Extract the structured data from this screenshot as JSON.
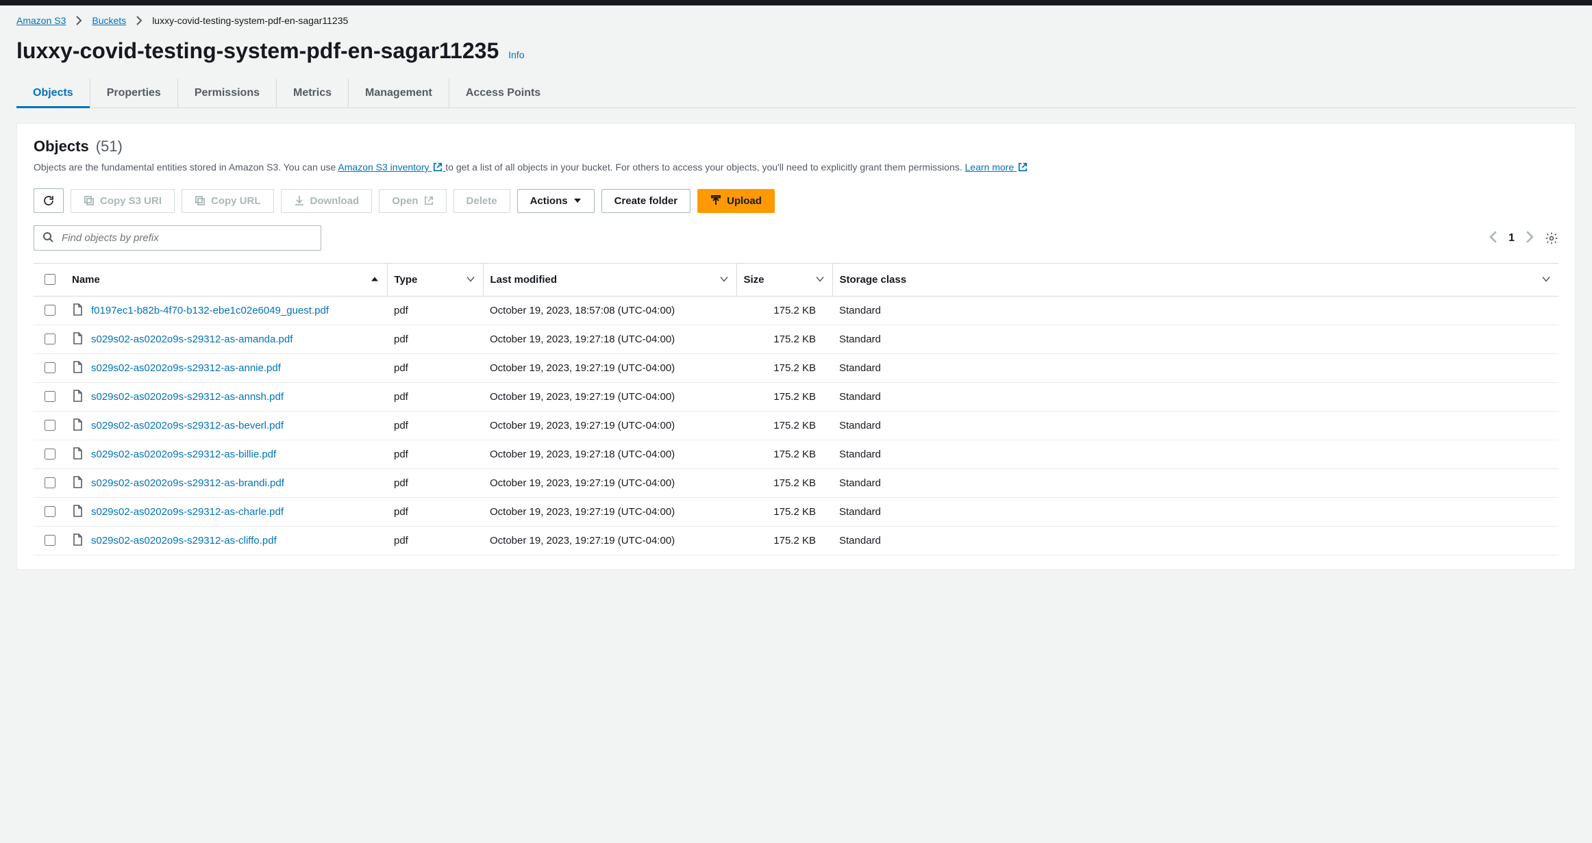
{
  "breadcrumbs": {
    "root": "Amazon S3",
    "buckets": "Buckets",
    "current": "luxxy-covid-testing-system-pdf-en-sagar11235"
  },
  "page_title": "luxxy-covid-testing-system-pdf-en-sagar11235",
  "info_label": "Info",
  "tabs": {
    "objects": "Objects",
    "properties": "Properties",
    "permissions": "Permissions",
    "metrics": "Metrics",
    "management": "Management",
    "access_points": "Access Points"
  },
  "panel": {
    "title": "Objects",
    "count": "(51)",
    "desc_pre": "Objects are the fundamental entities stored in Amazon S3. You can use ",
    "inventory_link": "Amazon S3 inventory ",
    "desc_mid": " to get a list of all objects in your bucket. For others to access your objects, you'll need to explicitly grant them permissions. ",
    "learn_more": "Learn more "
  },
  "toolbar": {
    "copy_s3_uri": "Copy S3 URI",
    "copy_url": "Copy URL",
    "download": "Download",
    "open": "Open",
    "delete": "Delete",
    "actions": "Actions",
    "create_folder": "Create folder",
    "upload": "Upload"
  },
  "search": {
    "placeholder": "Find objects by prefix"
  },
  "pager": {
    "page": "1"
  },
  "columns": {
    "name": "Name",
    "type": "Type",
    "last_modified": "Last modified",
    "size": "Size",
    "storage_class": "Storage class"
  },
  "rows": [
    {
      "name": "f0197ec1-b82b-4f70-b132-ebe1c02e6049_guest.pdf",
      "type": "pdf",
      "last_modified": "October 19, 2023, 18:57:08 (UTC-04:00)",
      "size": "175.2 KB",
      "storage_class": "Standard"
    },
    {
      "name": "s029s02-as0202o9s-s29312-as-amanda.pdf",
      "type": "pdf",
      "last_modified": "October 19, 2023, 19:27:18 (UTC-04:00)",
      "size": "175.2 KB",
      "storage_class": "Standard"
    },
    {
      "name": "s029s02-as0202o9s-s29312-as-annie.pdf",
      "type": "pdf",
      "last_modified": "October 19, 2023, 19:27:19 (UTC-04:00)",
      "size": "175.2 KB",
      "storage_class": "Standard"
    },
    {
      "name": "s029s02-as0202o9s-s29312-as-annsh.pdf",
      "type": "pdf",
      "last_modified": "October 19, 2023, 19:27:19 (UTC-04:00)",
      "size": "175.2 KB",
      "storage_class": "Standard"
    },
    {
      "name": "s029s02-as0202o9s-s29312-as-beverl.pdf",
      "type": "pdf",
      "last_modified": "October 19, 2023, 19:27:19 (UTC-04:00)",
      "size": "175.2 KB",
      "storage_class": "Standard"
    },
    {
      "name": "s029s02-as0202o9s-s29312-as-billie.pdf",
      "type": "pdf",
      "last_modified": "October 19, 2023, 19:27:18 (UTC-04:00)",
      "size": "175.2 KB",
      "storage_class": "Standard"
    },
    {
      "name": "s029s02-as0202o9s-s29312-as-brandi.pdf",
      "type": "pdf",
      "last_modified": "October 19, 2023, 19:27:19 (UTC-04:00)",
      "size": "175.2 KB",
      "storage_class": "Standard"
    },
    {
      "name": "s029s02-as0202o9s-s29312-as-charle.pdf",
      "type": "pdf",
      "last_modified": "October 19, 2023, 19:27:19 (UTC-04:00)",
      "size": "175.2 KB",
      "storage_class": "Standard"
    },
    {
      "name": "s029s02-as0202o9s-s29312-as-cliffo.pdf",
      "type": "pdf",
      "last_modified": "October 19, 2023, 19:27:19 (UTC-04:00)",
      "size": "175.2 KB",
      "storage_class": "Standard"
    }
  ]
}
